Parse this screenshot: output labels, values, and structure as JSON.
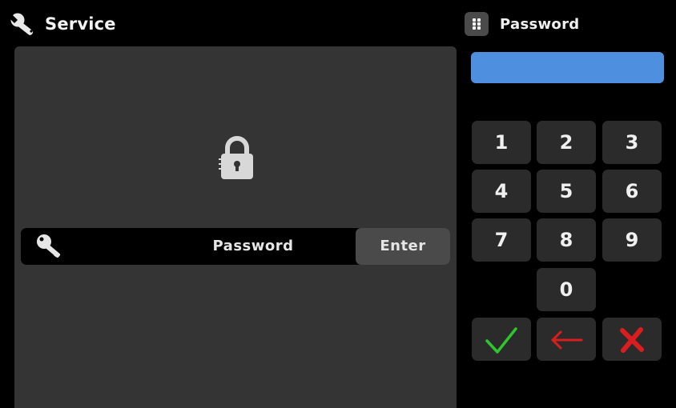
{
  "header": {
    "title": "Service",
    "title_icon": "wrench-icon"
  },
  "main": {
    "lock_icon": "lock-icon",
    "password_row": {
      "icon": "key-icon",
      "label": "Password",
      "enter_label": "Enter"
    }
  },
  "keypad": {
    "title": "Password",
    "menu_icon": "grid-dots-icon",
    "display_value": "",
    "keys": [
      "1",
      "2",
      "3",
      "4",
      "5",
      "6",
      "7",
      "8",
      "9",
      "0"
    ],
    "confirm_icon": "checkmark-icon",
    "backspace_icon": "arrow-left-icon",
    "cancel_icon": "x-icon"
  },
  "colors": {
    "display": "#4f8fe0",
    "confirm": "#2fc52f",
    "backspace": "#d81e1e",
    "cancel": "#d81e1e",
    "panel": "#343434",
    "key": "#2b2b2b"
  }
}
